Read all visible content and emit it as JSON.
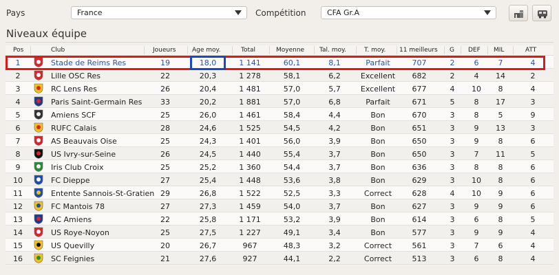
{
  "filters": {
    "pays_label": "Pays",
    "pays_value": "France",
    "competition_label": "Compétition",
    "competition_value": "CFA Gr.A"
  },
  "section_title": "Niveaux équipe",
  "columns": [
    "Pos",
    "Club",
    "Joueurs",
    "Age moy.",
    "Total",
    "Moyenne",
    "Tal. moy.",
    "T. moy.",
    "11 meilleurs",
    "G",
    "DEF",
    "MIL",
    "ATT"
  ],
  "rows": [
    {
      "pos": "1",
      "club": "Stade de Reims Res",
      "joueurs": "19",
      "age": "18,0",
      "total": "1 141",
      "moyenne": "60,1",
      "tal": "8,1",
      "tmoy": "Parfait",
      "best11": "707",
      "g": "2",
      "def": "6",
      "mil": "7",
      "att": "4",
      "crest": "#d8262c",
      "crest2": "#ffffff"
    },
    {
      "pos": "2",
      "club": "Lille OSC Res",
      "joueurs": "22",
      "age": "20,3",
      "total": "1 278",
      "moyenne": "58,1",
      "tal": "6,2",
      "tmoy": "Excellent",
      "best11": "682",
      "g": "2",
      "def": "4",
      "mil": "14",
      "att": "2",
      "crest": "#d8262c",
      "crest2": "#ffffff"
    },
    {
      "pos": "3",
      "club": "RC Lens Res",
      "joueurs": "26",
      "age": "20,4",
      "total": "1 481",
      "moyenne": "57,0",
      "tal": "5,7",
      "tmoy": "Excellent",
      "best11": "677",
      "g": "4",
      "def": "10",
      "mil": "8",
      "att": "4",
      "crest": "#f2c21a",
      "crest2": "#d8262c"
    },
    {
      "pos": "4",
      "club": "Paris Saint-Germain Res",
      "joueurs": "33",
      "age": "20,2",
      "total": "1 881",
      "moyenne": "57,0",
      "tal": "6,8",
      "tmoy": "Parfait",
      "best11": "671",
      "g": "5",
      "def": "8",
      "mil": "17",
      "att": "3",
      "crest": "#1e3a8a",
      "crest2": "#d8262c"
    },
    {
      "pos": "5",
      "club": "Amiens SCF",
      "joueurs": "25",
      "age": "26,0",
      "total": "1 461",
      "moyenne": "58,4",
      "tal": "4,4",
      "tmoy": "Bon",
      "best11": "670",
      "g": "3",
      "def": "8",
      "mil": "5",
      "att": "9",
      "crest": "#333333",
      "crest2": "#eeeeee"
    },
    {
      "pos": "6",
      "club": "RUFC Calais",
      "joueurs": "28",
      "age": "24,6",
      "total": "1 525",
      "moyenne": "54,5",
      "tal": "4,2",
      "tmoy": "Bon",
      "best11": "651",
      "g": "3",
      "def": "9",
      "mil": "13",
      "att": "3",
      "crest": "#f2c21a",
      "crest2": "#d8262c"
    },
    {
      "pos": "7",
      "club": "AS Beauvais Oise",
      "joueurs": "25",
      "age": "24,3",
      "total": "1 401",
      "moyenne": "56,0",
      "tal": "3,9",
      "tmoy": "Bon",
      "best11": "650",
      "g": "3",
      "def": "9",
      "mil": "8",
      "att": "6",
      "crest": "#d8262c",
      "crest2": "#ffffff"
    },
    {
      "pos": "8",
      "club": "US Ivry-sur-Seine",
      "joueurs": "26",
      "age": "24,5",
      "total": "1 440",
      "moyenne": "55,4",
      "tal": "3,7",
      "tmoy": "Bon",
      "best11": "650",
      "g": "3",
      "def": "7",
      "mil": "11",
      "att": "5",
      "crest": "#111111",
      "crest2": "#d8262c"
    },
    {
      "pos": "9",
      "club": "Iris Club Croix",
      "joueurs": "25",
      "age": "25,2",
      "total": "1 360",
      "moyenne": "54,4",
      "tal": "3,7",
      "tmoy": "Bon",
      "best11": "636",
      "g": "3",
      "def": "8",
      "mil": "8",
      "att": "6",
      "crest": "#2a8a3a",
      "crest2": "#ffffff"
    },
    {
      "pos": "10",
      "club": "FC Dieppe",
      "joueurs": "27",
      "age": "25,4",
      "total": "1 448",
      "moyenne": "53,6",
      "tal": "3,8",
      "tmoy": "Bon",
      "best11": "629",
      "g": "3",
      "def": "10",
      "mil": "8",
      "att": "6",
      "crest": "#1e4fa8",
      "crest2": "#ffffff"
    },
    {
      "pos": "11",
      "club": "Entente Sannois-St-Gratien",
      "joueurs": "29",
      "age": "26,8",
      "total": "1 522",
      "moyenne": "52,5",
      "tal": "3,3",
      "tmoy": "Correct",
      "best11": "628",
      "g": "4",
      "def": "10",
      "mil": "9",
      "att": "6",
      "crest": "#1e4fa8",
      "crest2": "#f2c21a"
    },
    {
      "pos": "12",
      "club": "FC Mantois 78",
      "joueurs": "27",
      "age": "27,3",
      "total": "1 459",
      "moyenne": "54,0",
      "tal": "3,7",
      "tmoy": "Bon",
      "best11": "627",
      "g": "3",
      "def": "9",
      "mil": "9",
      "att": "6",
      "crest": "#f2c21a",
      "crest2": "#1e4fa8"
    },
    {
      "pos": "13",
      "club": "AC Amiens",
      "joueurs": "22",
      "age": "25,8",
      "total": "1 171",
      "moyenne": "53,2",
      "tal": "3,9",
      "tmoy": "Bon",
      "best11": "614",
      "g": "3",
      "def": "6",
      "mil": "8",
      "att": "5",
      "crest": "#1e3a8a",
      "crest2": "#d8262c"
    },
    {
      "pos": "14",
      "club": "US Roye-Noyon",
      "joueurs": "25",
      "age": "27,5",
      "total": "1 227",
      "moyenne": "49,1",
      "tal": "3,4",
      "tmoy": "Bon",
      "best11": "577",
      "g": "3",
      "def": "9",
      "mil": "9",
      "att": "4",
      "crest": "#d8262c",
      "crest2": "#ffffff"
    },
    {
      "pos": "15",
      "club": "US Quevilly",
      "joueurs": "20",
      "age": "26,7",
      "total": "967",
      "moyenne": "48,3",
      "tal": "3,2",
      "tmoy": "Correct",
      "best11": "561",
      "g": "3",
      "def": "7",
      "mil": "6",
      "att": "4",
      "crest": "#f2c21a",
      "crest2": "#111111"
    },
    {
      "pos": "16",
      "club": "SC Feignies",
      "joueurs": "21",
      "age": "27,6",
      "total": "927",
      "moyenne": "44,1",
      "tal": "2,2",
      "tmoy": "Correct",
      "best11": "513",
      "g": "3",
      "def": "6",
      "mil": "8",
      "att": "4",
      "crest": "#f2c21a",
      "crest2": "#2a8a3a"
    }
  ]
}
